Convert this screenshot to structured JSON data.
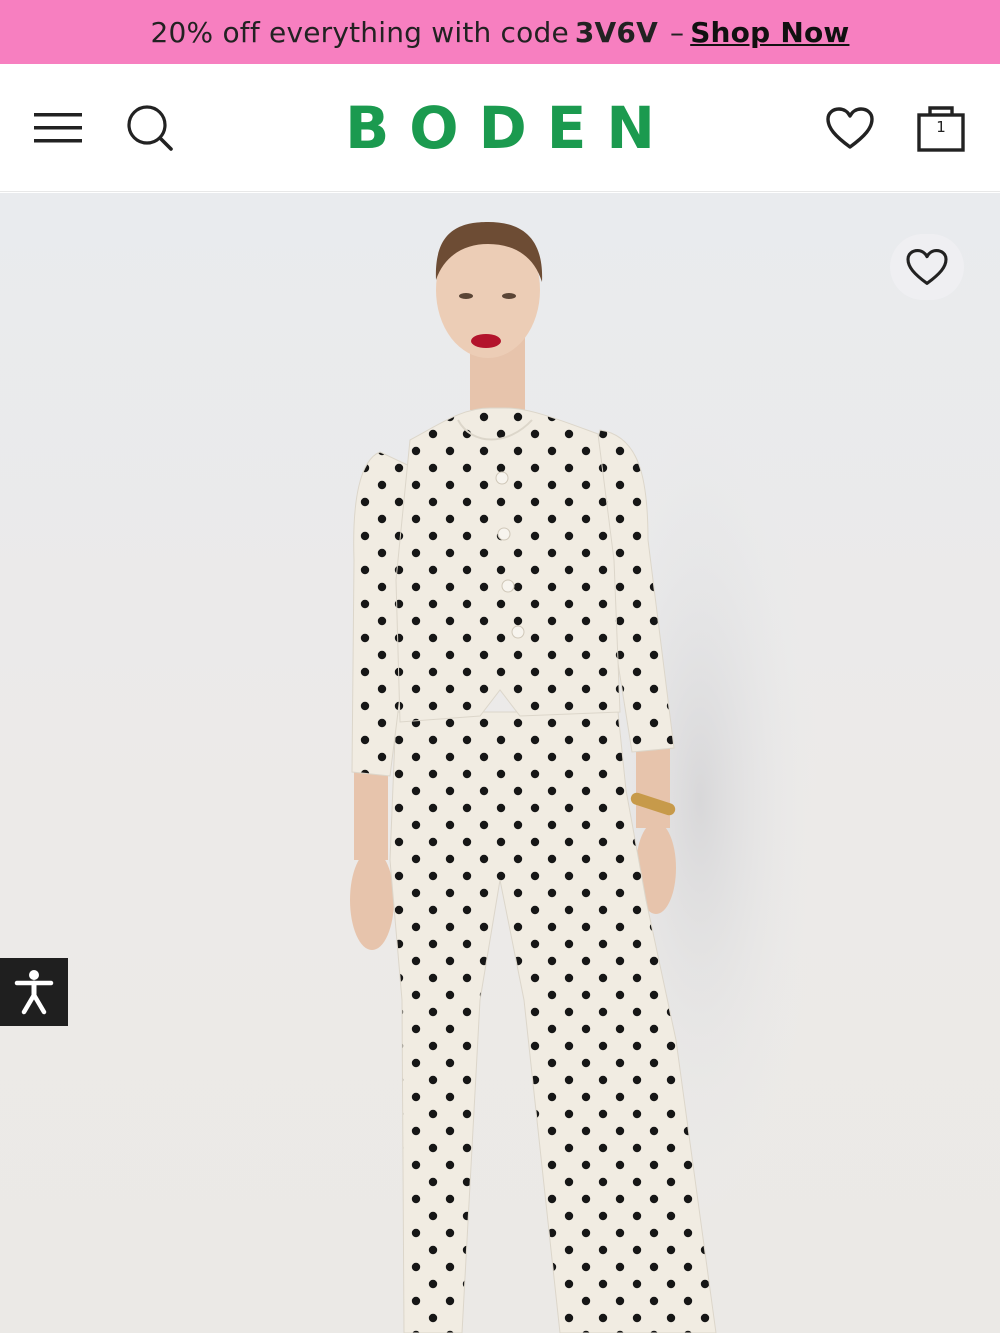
{
  "promo": {
    "text": "20% off everything with code",
    "code": "3V6V",
    "separator": "–",
    "cta": "Shop Now",
    "background": "#f77fc0"
  },
  "header": {
    "logo": "BODEN",
    "logo_color": "#1b9a4f",
    "icons": [
      "menu-icon",
      "search-icon",
      "heart-icon",
      "shopping-bag-icon"
    ],
    "bag_count": "1"
  },
  "product": {
    "image_alt": "Model wearing cream polka dot jacket and wide leg trousers",
    "favourite_icon": "heart-icon"
  },
  "accessibility": {
    "icon": "accessibility-icon"
  }
}
